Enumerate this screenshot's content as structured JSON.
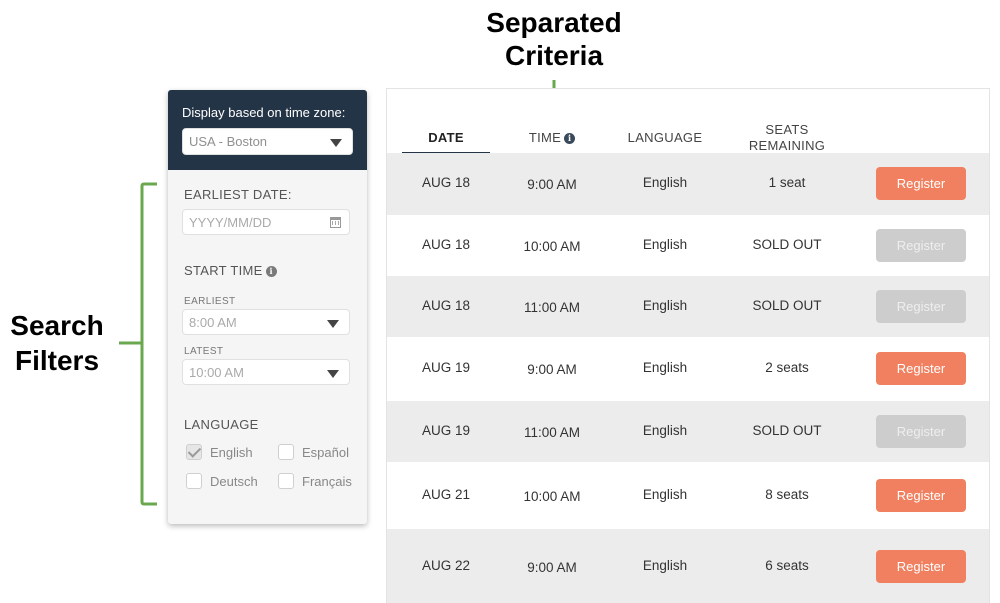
{
  "annotations": {
    "top_line1": "Separated",
    "top_line2": "Criteria",
    "left_line1": "Search",
    "left_line2": "Filters",
    "bracket_color": "#6aa84f"
  },
  "filters": {
    "timezone_label": "Display based on time zone:",
    "timezone_value": "USA - Boston",
    "earliest_date_label": "EARLIEST DATE:",
    "date_placeholder": "YYYY/MM/DD",
    "start_time_label": "START TIME",
    "earliest_label": "EARLIEST",
    "earliest_value": "8:00 AM",
    "latest_label": "LATEST",
    "latest_value": "10:00 AM",
    "language_label": "LANGUAGE",
    "languages": [
      {
        "label": "English",
        "checked": true
      },
      {
        "label": "Español",
        "checked": false
      },
      {
        "label": "Deutsch",
        "checked": false
      },
      {
        "label": "Français",
        "checked": false
      }
    ]
  },
  "table": {
    "headers": {
      "date": "DATE",
      "time": "TIME",
      "language": "LANGUAGE",
      "seats_line1": "SEATS",
      "seats_line2": "REMAINING"
    },
    "register_label": "Register",
    "rows": [
      {
        "date": "AUG 18",
        "time": "9:00 AM",
        "language": "English",
        "seats": "1 seat",
        "available": true
      },
      {
        "date": "AUG 18",
        "time": "10:00 AM",
        "language": "English",
        "seats": "SOLD OUT",
        "available": false
      },
      {
        "date": "AUG 18",
        "time": "11:00 AM",
        "language": "English",
        "seats": "SOLD OUT",
        "available": false
      },
      {
        "date": "AUG 19",
        "time": "9:00 AM",
        "language": "English",
        "seats": "2 seats",
        "available": true
      },
      {
        "date": "AUG 19",
        "time": "11:00 AM",
        "language": "English",
        "seats": "SOLD OUT",
        "available": false
      },
      {
        "date": "AUG 21",
        "time": "10:00 AM",
        "language": "English",
        "seats": "8 seats",
        "available": true
      },
      {
        "date": "AUG 22",
        "time": "9:00 AM",
        "language": "English",
        "seats": "6 seats",
        "available": true
      }
    ]
  }
}
